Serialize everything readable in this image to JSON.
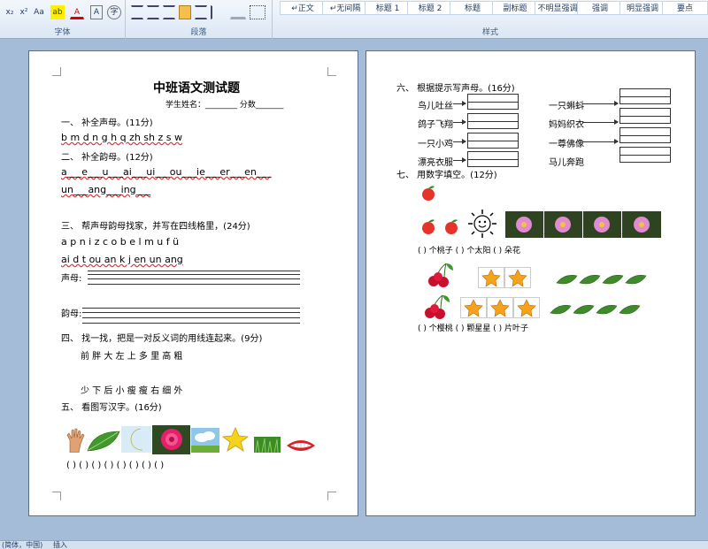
{
  "ribbon": {
    "font_group": "字体",
    "para_group": "段落",
    "styles_group": "样式",
    "font_btns": [
      "x₂",
      "x²",
      "Aa",
      "ab",
      "A",
      "A",
      "字"
    ],
    "styles": [
      "↵正文",
      "↵无间隔",
      "标题 1",
      "标题 2",
      "标题",
      "副标题",
      "不明显强调",
      "强调",
      "明显强调",
      "要点"
    ]
  },
  "page1": {
    "title": "中班语文测试题",
    "student": "学生姓名：________ 分数_______",
    "s1": "一、 补全声母。(11分)",
    "s1_line": "b  m  d  n  g  h  q  zh  sh  z  s  w",
    "s2": "二、 补全韵母。(12分)",
    "s2_line1": "a___e___u___ai___ui___ou___ie___er___en___",
    "s2_line2": "un___ang___ing___",
    "s3": "三、 帮声母韵母找家，并写在四线格里，(24分)",
    "s3_line1": "a   p   n   i   z   c   o   b   e   l   m   u   f   ü",
    "s3_line2": "ai   d   t   ou   an   k   j   en   un   ang",
    "shengmu": "声母:",
    "yunmu": "韵母:",
    "s4": "四、 找一找，把是一对反义词的用线连起来。(9分)",
    "s4_line1": "前   胖   大   左   上   多   里   高   粗",
    "s4_line2": "少   下   后     小   瘦   瘦   右   细   外",
    "s5": "五、 看图写汉字。(16分)",
    "s5_blanks": "( ) ( )     (   ) (   )     (   ) (   )  (   )     (   )"
  },
  "page2": {
    "s6": "六、 根据提示写声母。(16分)",
    "left_items": [
      "鸟儿吐丝",
      "鸽子飞翔",
      "一只小鸡",
      "漂亮衣服"
    ],
    "right_items": [
      "一只蝌蚪",
      "妈妈织衣",
      "一尊佛像",
      "马儿奔跑"
    ],
    "s7": "七、 用数字填空。(12分)",
    "row1_blanks": "(     ) 个桃子    (     ) 个太阳    (     ) 朵花",
    "row2_blanks": "(     ) 个樱桃  (     ) 颗星星 (     ) 片叶子"
  },
  "status": {
    "lang": "(简体，中国)",
    "insert": "插入"
  }
}
